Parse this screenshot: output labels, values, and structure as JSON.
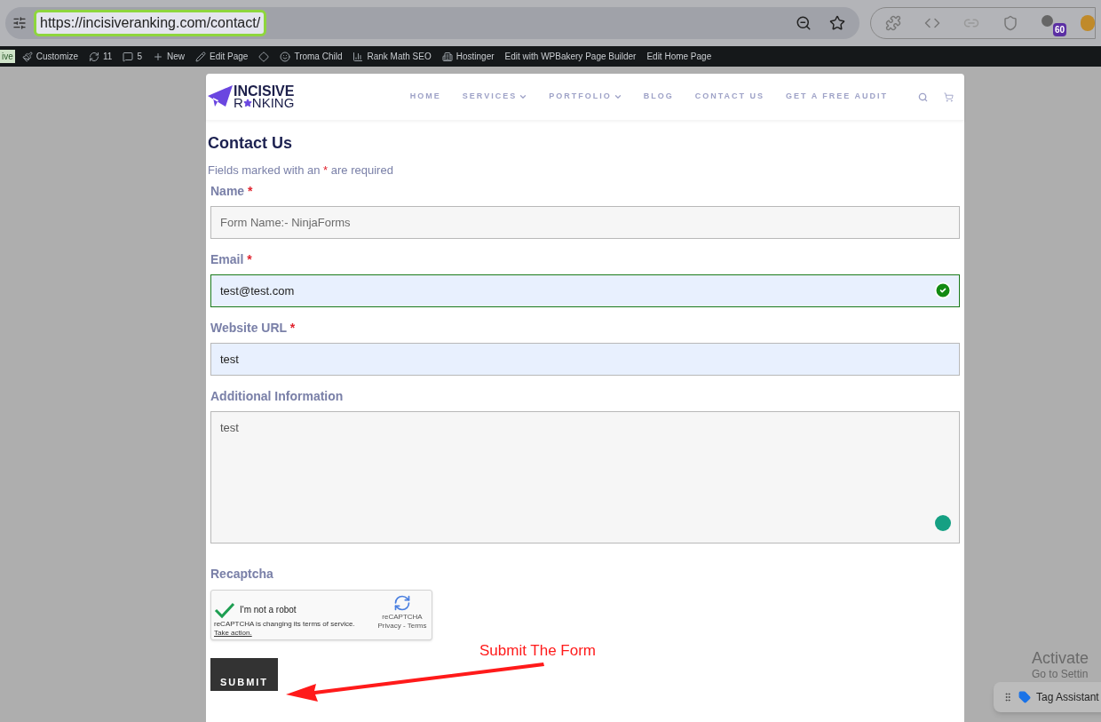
{
  "browser": {
    "url": "https://incisiveranking.com/contact/",
    "extension_badge": "60"
  },
  "admin_bar": {
    "live_badge": "ive",
    "items": [
      {
        "kind": "brush",
        "label": "Customize"
      },
      {
        "kind": "sync",
        "label": "11"
      },
      {
        "kind": "comment",
        "label": "5"
      },
      {
        "kind": "plus",
        "label": "New"
      },
      {
        "kind": "pencil",
        "label": "Edit Page"
      },
      {
        "kind": "diamond"
      },
      {
        "kind": "smile",
        "label": "Troma Child"
      },
      {
        "kind": "chart",
        "label": "Rank Math SEO"
      },
      {
        "kind": "hostinger",
        "label": "Hostinger"
      },
      {
        "kind": "none",
        "label": "Edit with WPBakery Page Builder"
      },
      {
        "kind": "none",
        "label": "Edit Home Page"
      }
    ]
  },
  "site": {
    "logo_top": "INCISIVE",
    "logo_bottom_a": "R",
    "logo_bottom_b": "NKING",
    "nav": [
      {
        "label": "HOME",
        "dropdown": false
      },
      {
        "label": "SERVICES",
        "dropdown": true
      },
      {
        "label": "PORTFOLIO",
        "dropdown": true
      },
      {
        "label": "BLOG",
        "dropdown": false
      },
      {
        "label": "CONTACT US",
        "dropdown": false
      },
      {
        "label": "GET A FREE AUDIT",
        "dropdown": false
      }
    ]
  },
  "form": {
    "title": "Contact Us",
    "required_note_a": "Fields marked with an",
    "required_mark": "*",
    "required_note_b": "are required",
    "fields": [
      {
        "kind": "text",
        "label": "Name",
        "required": true,
        "placeholder": "Form Name:- NinjaForms",
        "autofilled": false,
        "valid": false
      },
      {
        "kind": "text",
        "label": "Email",
        "required": true,
        "value": "test@test.com",
        "autofilled": true,
        "valid": true
      },
      {
        "kind": "text",
        "label": "Website URL",
        "required": true,
        "value": "test",
        "autofilled": true,
        "valid": false
      },
      {
        "kind": "textarea",
        "label": "Additional Information",
        "required": false,
        "value": "test",
        "autofilled": false,
        "valid": false
      }
    ],
    "recaptcha": {
      "label": "Recaptcha",
      "checked": true,
      "text": "I'm not a robot",
      "notice": "reCAPTCHA is changing its terms of service.",
      "notice_link": "Take action.",
      "brand": "reCAPTCHA",
      "links": "Privacy - Terms"
    },
    "submit": "SUBMIT"
  },
  "annotation": "Submit The Form",
  "windows_notice": {
    "title": "Activate",
    "subtitle": "Go to Settin"
  },
  "tag_assistant": "Tag Assistant"
}
